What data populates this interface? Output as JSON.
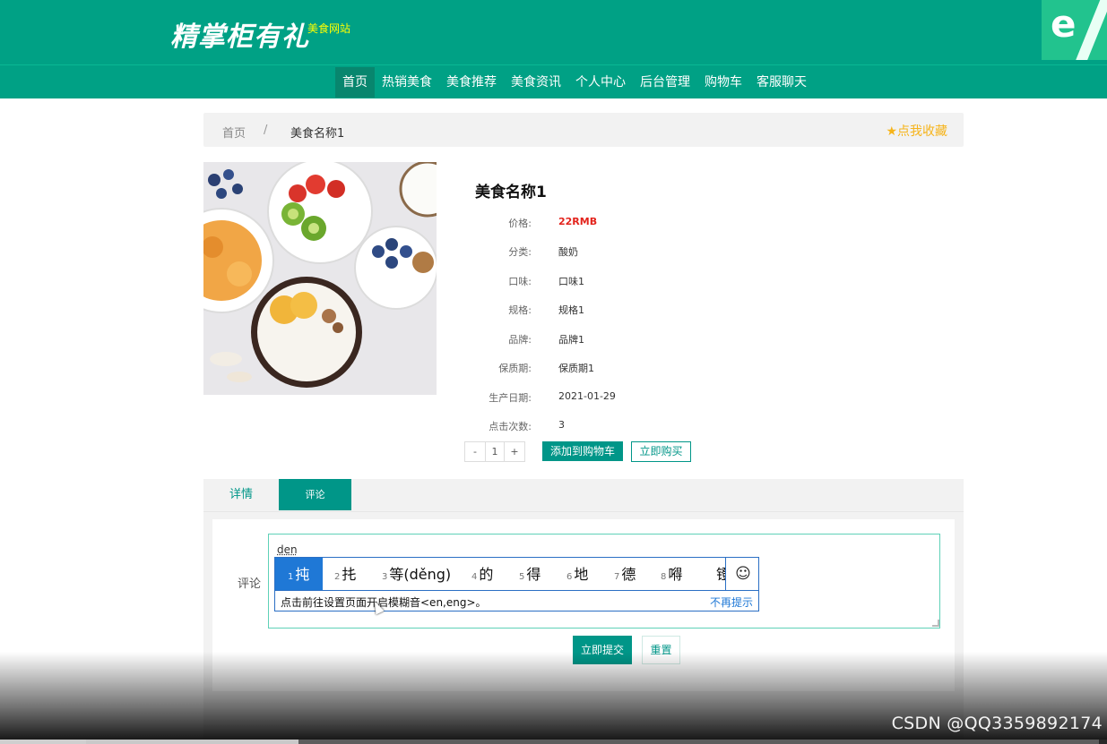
{
  "header": {
    "logo_text": "精掌柜有礼",
    "site_subtitle": "美食网站",
    "nav": [
      {
        "label": "首页",
        "active": true
      },
      {
        "label": "热销美食"
      },
      {
        "label": "美食推荐"
      },
      {
        "label": "美食资讯"
      },
      {
        "label": "个人中心"
      },
      {
        "label": "后台管理"
      },
      {
        "label": "购物车"
      },
      {
        "label": "客服聊天"
      }
    ],
    "corner_icon": "ie-browser-icon"
  },
  "breadcrumb": {
    "home": "首页",
    "separator": "/",
    "current": "美食名称1",
    "favorite_label": "点我收藏",
    "favorite_icon": "star-icon"
  },
  "product": {
    "title": "美食名称1",
    "attributes": [
      {
        "label": "价格:",
        "value": "22RMB"
      },
      {
        "label": "分类:",
        "value": "酸奶"
      },
      {
        "label": "口味:",
        "value": "口味1"
      },
      {
        "label": "规格:",
        "value": "规格1"
      },
      {
        "label": "品牌:",
        "value": "品牌1"
      },
      {
        "label": "保质期:",
        "value": "保质期1"
      },
      {
        "label": "生产日期:",
        "value": "2021-01-29"
      },
      {
        "label": "点击次数:",
        "value": "3"
      }
    ],
    "quantity": {
      "minus": "-",
      "value": "1",
      "plus": "+"
    },
    "add_to_cart_label": "添加到购物车",
    "buy_now_label": "立即购买"
  },
  "tabs": [
    {
      "label": "详情",
      "active": false
    },
    {
      "label": "评论",
      "active": true
    }
  ],
  "comment": {
    "label": "评论",
    "typed_text": "den",
    "submit_label": "立即提交",
    "reset_label": "重置"
  },
  "ime": {
    "candidates": [
      {
        "num": "1",
        "text": "扽",
        "selected": true
      },
      {
        "num": "2",
        "text": "扥"
      },
      {
        "num": "3",
        "text": "等(děng)"
      },
      {
        "num": "4",
        "text": "的"
      },
      {
        "num": "5",
        "text": "得"
      },
      {
        "num": "6",
        "text": "地"
      },
      {
        "num": "7",
        "text": "德"
      },
      {
        "num": "8",
        "text": "嘚"
      },
      {
        "num": "",
        "text": "镫"
      }
    ],
    "emoji_icon": "☺",
    "hint": "点击前往设置页面开启模糊音<en,eng>。",
    "dismiss": "不再提示"
  },
  "watermark": "CSDN @QQ3359892174",
  "colors": {
    "brand": "#00a185",
    "button": "#009688",
    "price": "#e3231c",
    "favorite": "#f6b41a",
    "ime_blue": "#1f78d6"
  }
}
